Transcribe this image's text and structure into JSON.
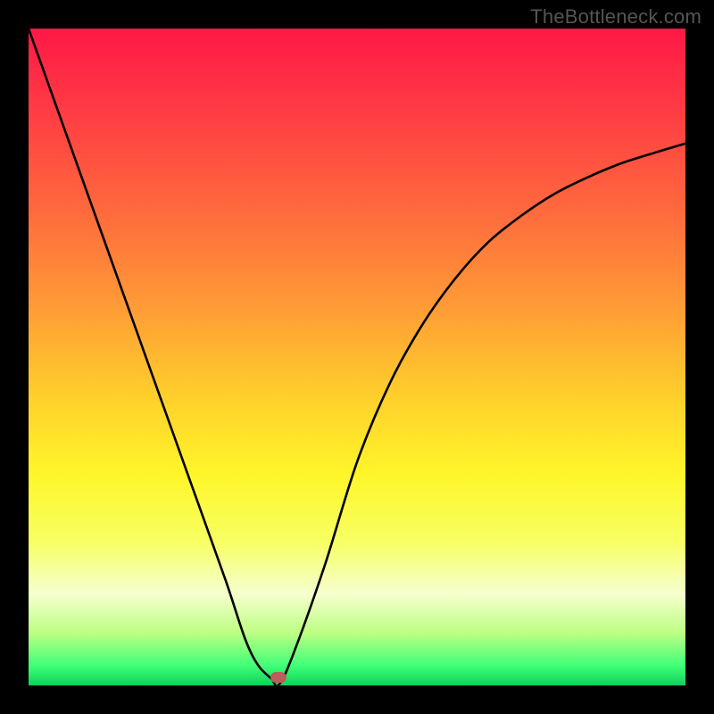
{
  "watermark": "TheBottleneck.com",
  "chart_data": {
    "type": "line",
    "title": "",
    "xlabel": "",
    "ylabel": "",
    "xlim": [
      0,
      100
    ],
    "ylim": [
      0,
      100
    ],
    "series": [
      {
        "name": "curve",
        "x": [
          0,
          5,
          10,
          15,
          20,
          25,
          30,
          33,
          35,
          37,
          38,
          40,
          45,
          50,
          55,
          60,
          65,
          70,
          75,
          80,
          85,
          90,
          95,
          100
        ],
        "values": [
          100,
          86,
          72,
          58,
          44,
          30,
          16,
          7,
          3,
          1,
          0,
          4,
          18,
          34,
          46,
          55,
          62,
          67.5,
          71.5,
          74.8,
          77.3,
          79.4,
          81,
          82.5
        ]
      }
    ],
    "marker": {
      "x": 38,
      "y": 1.2,
      "color": "#bb5d58"
    },
    "grid": false,
    "legend": false
  }
}
